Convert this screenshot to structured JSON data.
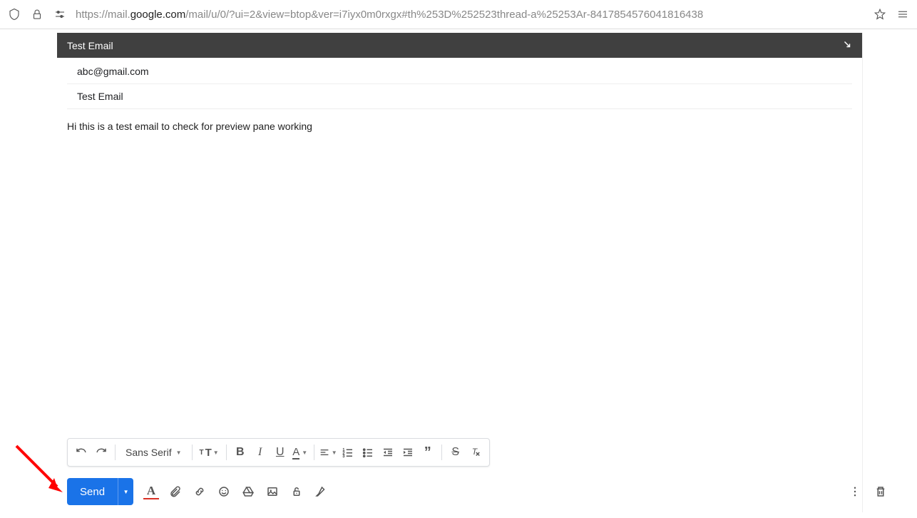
{
  "browser": {
    "url_prefix": "https://mail.",
    "url_domain": "google.com",
    "url_rest": "/mail/u/0/?ui=2&view=btop&ver=i7iyx0m0rxgx#th%253D%252523thread-a%25253Ar-8417854576041816438"
  },
  "compose": {
    "title": "Test Email",
    "to": "abc@gmail.com",
    "subject": "Test Email",
    "body": "Hi this is a test email to check for preview pane working"
  },
  "format_toolbar": {
    "font": "Sans Serif"
  },
  "actions": {
    "send": "Send",
    "format_letter": "A"
  }
}
